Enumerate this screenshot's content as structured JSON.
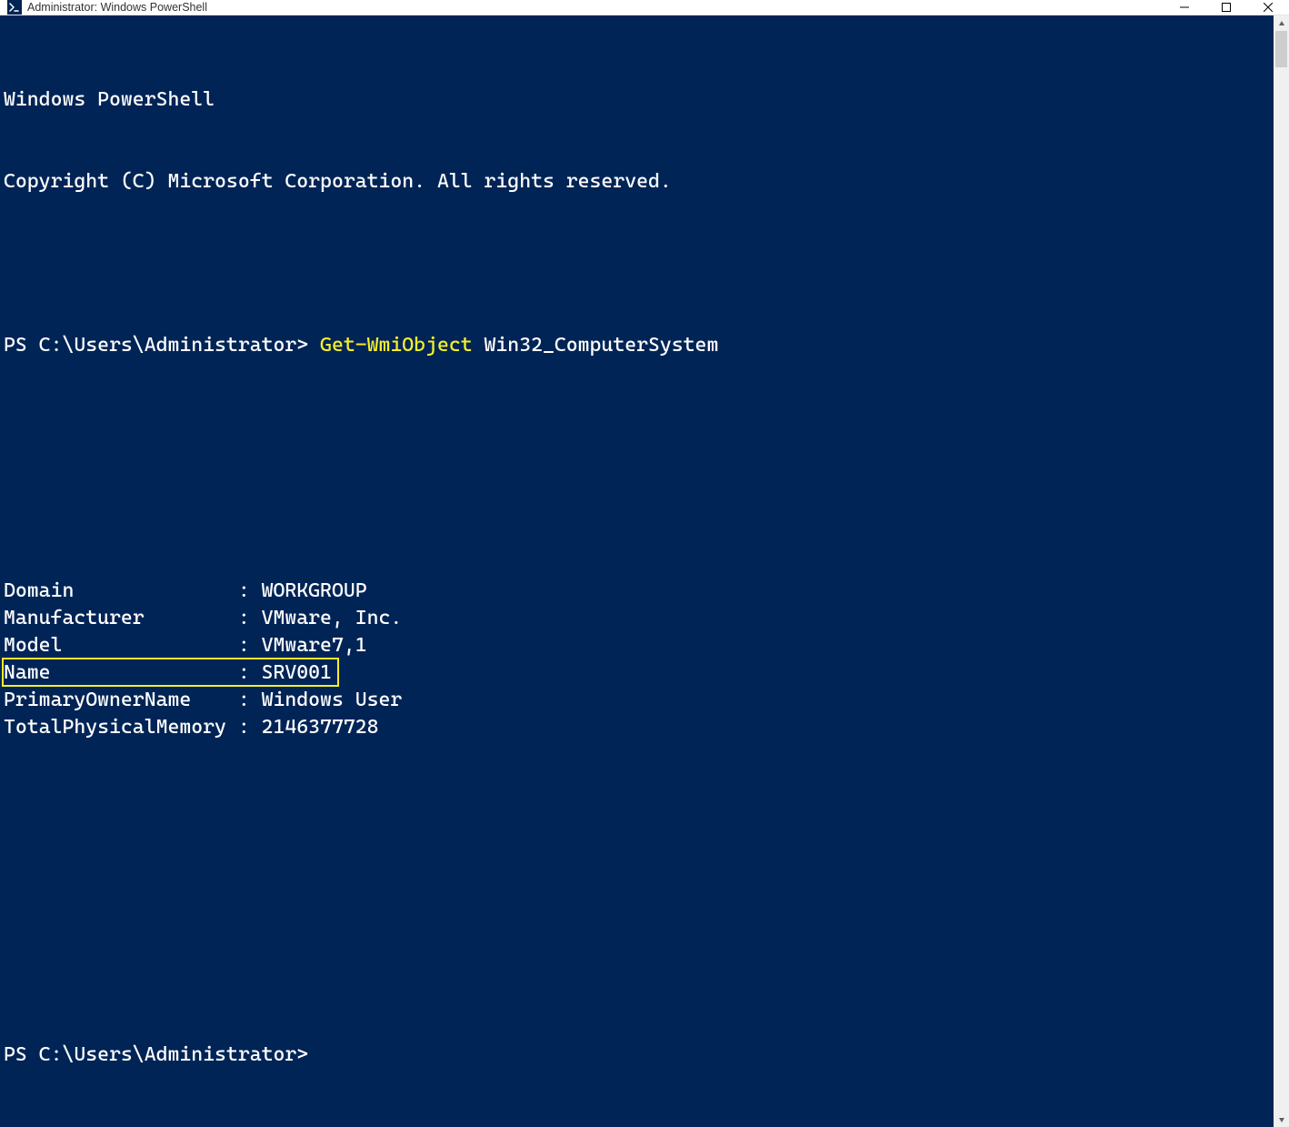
{
  "window": {
    "title": "Administrator: Windows PowerShell"
  },
  "terminal": {
    "banner_line1": "Windows PowerShell",
    "banner_line2": "Copyright (C) Microsoft Corporation. All rights reserved.",
    "prompt1_prefix": "PS C:\\Users\\Administrator> ",
    "prompt1_cmd": "Get-WmiObject",
    "prompt1_arg": " Win32_ComputerSystem",
    "output": [
      {
        "key": "Domain",
        "sep": ": ",
        "val": "WORKGROUP"
      },
      {
        "key": "Manufacturer",
        "sep": ": ",
        "val": "VMware, Inc."
      },
      {
        "key": "Model",
        "sep": ": ",
        "val": "VMware7,1"
      },
      {
        "key": "Name",
        "sep": ": ",
        "val": "SRV001",
        "highlight": true
      },
      {
        "key": "PrimaryOwnerName",
        "sep": ": ",
        "val": "Windows User"
      },
      {
        "key": "TotalPhysicalMemory",
        "sep": ": ",
        "val": "2146377728"
      }
    ],
    "prompt2": "PS C:\\Users\\Administrator>"
  },
  "colors": {
    "terminal_bg": "#012456",
    "terminal_fg": "#ffffff",
    "cmdlet": "#f5ee2b",
    "highlight_border": "#f5ee2b"
  }
}
